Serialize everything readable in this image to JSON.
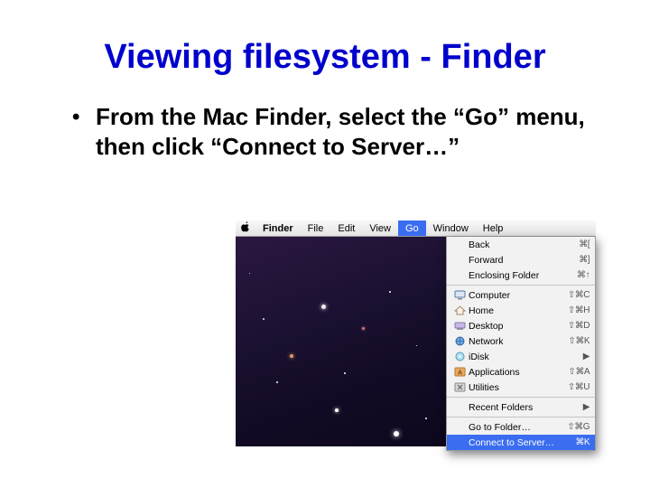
{
  "slide": {
    "title": "Viewing filesystem - Finder",
    "bullet": "From the Mac Finder, select the “Go” menu, then click “Connect to Server…”"
  },
  "menubar": {
    "apple": "",
    "app": "Finder",
    "items": [
      "File",
      "Edit",
      "View",
      "Go",
      "Window",
      "Help"
    ],
    "selected": "Go"
  },
  "go_menu": {
    "nav": [
      {
        "label": "Back",
        "shortcut": "⌘["
      },
      {
        "label": "Forward",
        "shortcut": "⌘]"
      },
      {
        "label": "Enclosing Folder",
        "shortcut": "⌘↑"
      }
    ],
    "places": [
      {
        "icon": "computer",
        "label": "Computer",
        "shortcut": "⇧⌘C"
      },
      {
        "icon": "home",
        "label": "Home",
        "shortcut": "⇧⌘H"
      },
      {
        "icon": "desktop",
        "label": "Desktop",
        "shortcut": "⇧⌘D"
      },
      {
        "icon": "network",
        "label": "Network",
        "shortcut": "⇧⌘K"
      },
      {
        "icon": "idisk",
        "label": "iDisk",
        "submenu": true
      },
      {
        "icon": "applications",
        "label": "Applications",
        "shortcut": "⇧⌘A"
      },
      {
        "icon": "utilities",
        "label": "Utilities",
        "shortcut": "⇧⌘U"
      }
    ],
    "recent": {
      "label": "Recent Folders",
      "submenu": true
    },
    "goto": {
      "label": "Go to Folder…",
      "shortcut": "⇧⌘G"
    },
    "connect": {
      "label": "Connect to Server…",
      "shortcut": "⌘K",
      "selected": true
    }
  }
}
